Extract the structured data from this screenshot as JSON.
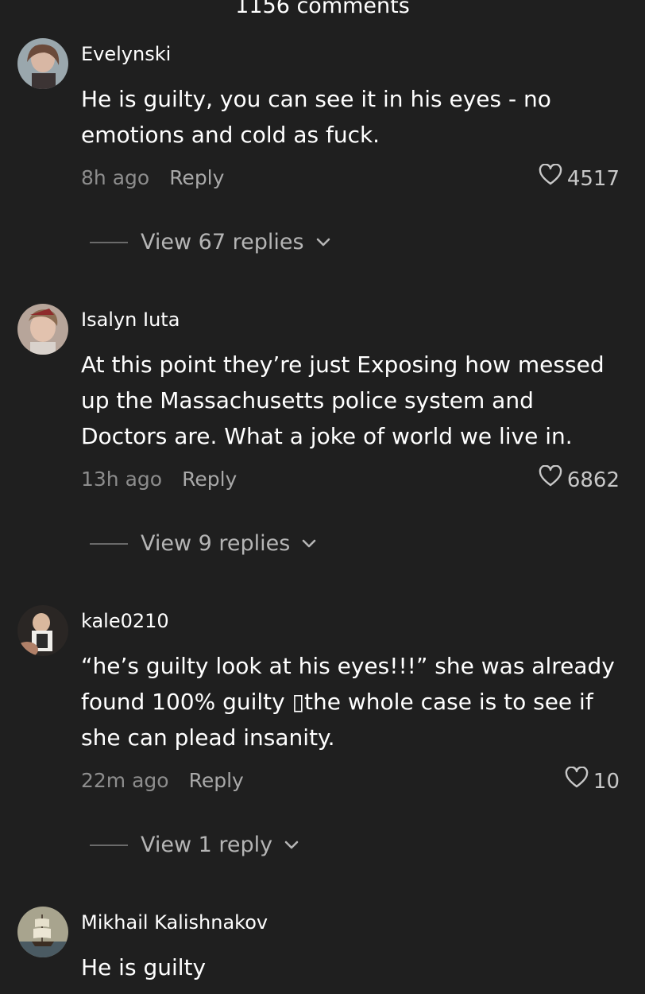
{
  "header": {
    "comment_count": "1156 comments"
  },
  "comments": [
    {
      "username": "Evelynski",
      "text": "He is guilty, you can see it in his eyes - no emotions and cold as fuck.",
      "time": "8h ago",
      "reply_label": "Reply",
      "likes": "4517",
      "view_replies": "View 67 replies"
    },
    {
      "username": "Isalyn Iuta",
      "text": "At this point they’re just Exposing how messed up the Massachusetts police system and Doctors are. What a joke of world we live in.",
      "time": "13h ago",
      "reply_label": "Reply",
      "likes": "6862",
      "view_replies": "View 9 replies"
    },
    {
      "username": "kale0210",
      "text": "“he’s guilty look at his eyes!!!” she was already found 100% guilty ▯the whole case is to see if she can plead insanity.",
      "time": "22m ago",
      "reply_label": "Reply",
      "likes": "10",
      "view_replies": "View 1 reply"
    },
    {
      "username": "Mikhail Kalishnakov",
      "text": "He is guilty"
    }
  ],
  "icons": {
    "like": "heart-outline-icon",
    "expand": "chevron-down-icon"
  },
  "colors": {
    "background": "#1f1f1f",
    "text": "#ffffff",
    "muted": "#8d8d8d"
  }
}
